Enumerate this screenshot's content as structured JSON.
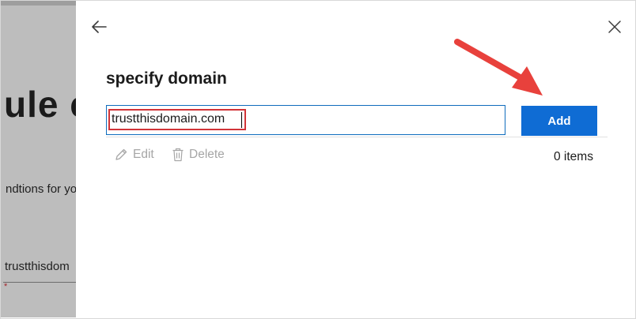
{
  "background_page": {
    "heading_fragment": "ule co",
    "description_fragment": "ndtions for yo",
    "field_value_fragment": "trustthisdom",
    "required_marker": "*"
  },
  "panel": {
    "title": "specify domain",
    "domain_input": {
      "value": "trustthisdomain.com",
      "placeholder": ""
    },
    "add_button_label": "Add",
    "toolbar": {
      "edit_label": "Edit",
      "delete_label": "Delete"
    },
    "items_count_label": "0 items"
  },
  "icons": {
    "back": "back-arrow-icon",
    "close": "close-icon",
    "edit": "pencil-icon",
    "delete": "trash-icon"
  },
  "colors": {
    "accent": "#0f6cd4",
    "highlight": "#d13438",
    "annotation_arrow": "#e8413c"
  }
}
